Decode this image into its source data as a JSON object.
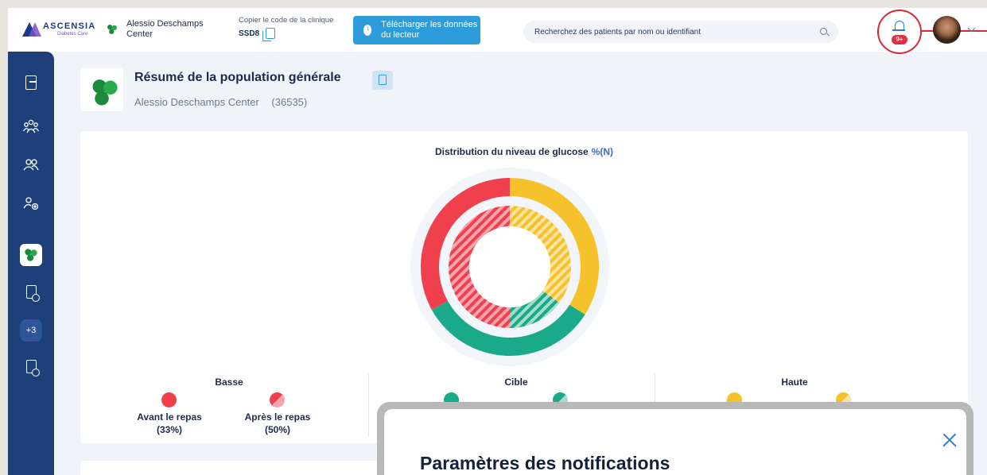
{
  "header": {
    "brand_name": "ASCENSIA",
    "brand_sub": "Diabetes Care",
    "clinic_name": "Alessio Deschamps Center",
    "copy_code_label": "Copier le code de la clinique",
    "copy_code_value": "SSD8",
    "download_button": "Télécharger les données du lecteur",
    "search_placeholder": "Recherchez des patients par nom ou identifiant",
    "notification_badge": "9+"
  },
  "sidebar": {
    "more_badge": "+3",
    "items": [
      "exit-icon",
      "population-icon",
      "patients-icon",
      "add-patient-icon",
      "clinic-clover-icon",
      "report-settings-icon",
      "more",
      "add-report-icon"
    ]
  },
  "main": {
    "page_title": "Résumé de la population générale",
    "clinic_name": "Alessio Deschamps Center",
    "clinic_id": "(36535)"
  },
  "chart": {
    "title": "Distribution du niveau de glucose",
    "unit": "%(N)",
    "legend_groups": [
      {
        "label": "Basse",
        "items": [
          {
            "label": "Avant le repas",
            "value": "(33%)"
          },
          {
            "label": "Après le repas",
            "value": "(50%)"
          }
        ]
      },
      {
        "label": "Cible"
      },
      {
        "label": "Haute"
      }
    ]
  },
  "chart_data": {
    "type": "pie",
    "title": "Distribution du niveau de glucose",
    "unit": "%(N)",
    "categories": [
      "Basse",
      "Cible",
      "Haute"
    ],
    "series": [
      {
        "name": "Avant le repas",
        "values": [
          33,
          33,
          34
        ]
      },
      {
        "name": "Après le repas",
        "values": [
          50,
          15,
          35
        ]
      }
    ],
    "colors": {
      "Basse": "#f0404e",
      "Cible": "#1aaa8a",
      "Haute": "#f5c22b"
    }
  },
  "modal": {
    "title": "Paramètres des notifications"
  },
  "colors": {
    "primary": "#2d9cdb",
    "sidebar": "#1e3f7a",
    "low": "#f0404e",
    "target": "#1aaa8a",
    "high": "#f5c22b",
    "alert": "#e03142"
  }
}
